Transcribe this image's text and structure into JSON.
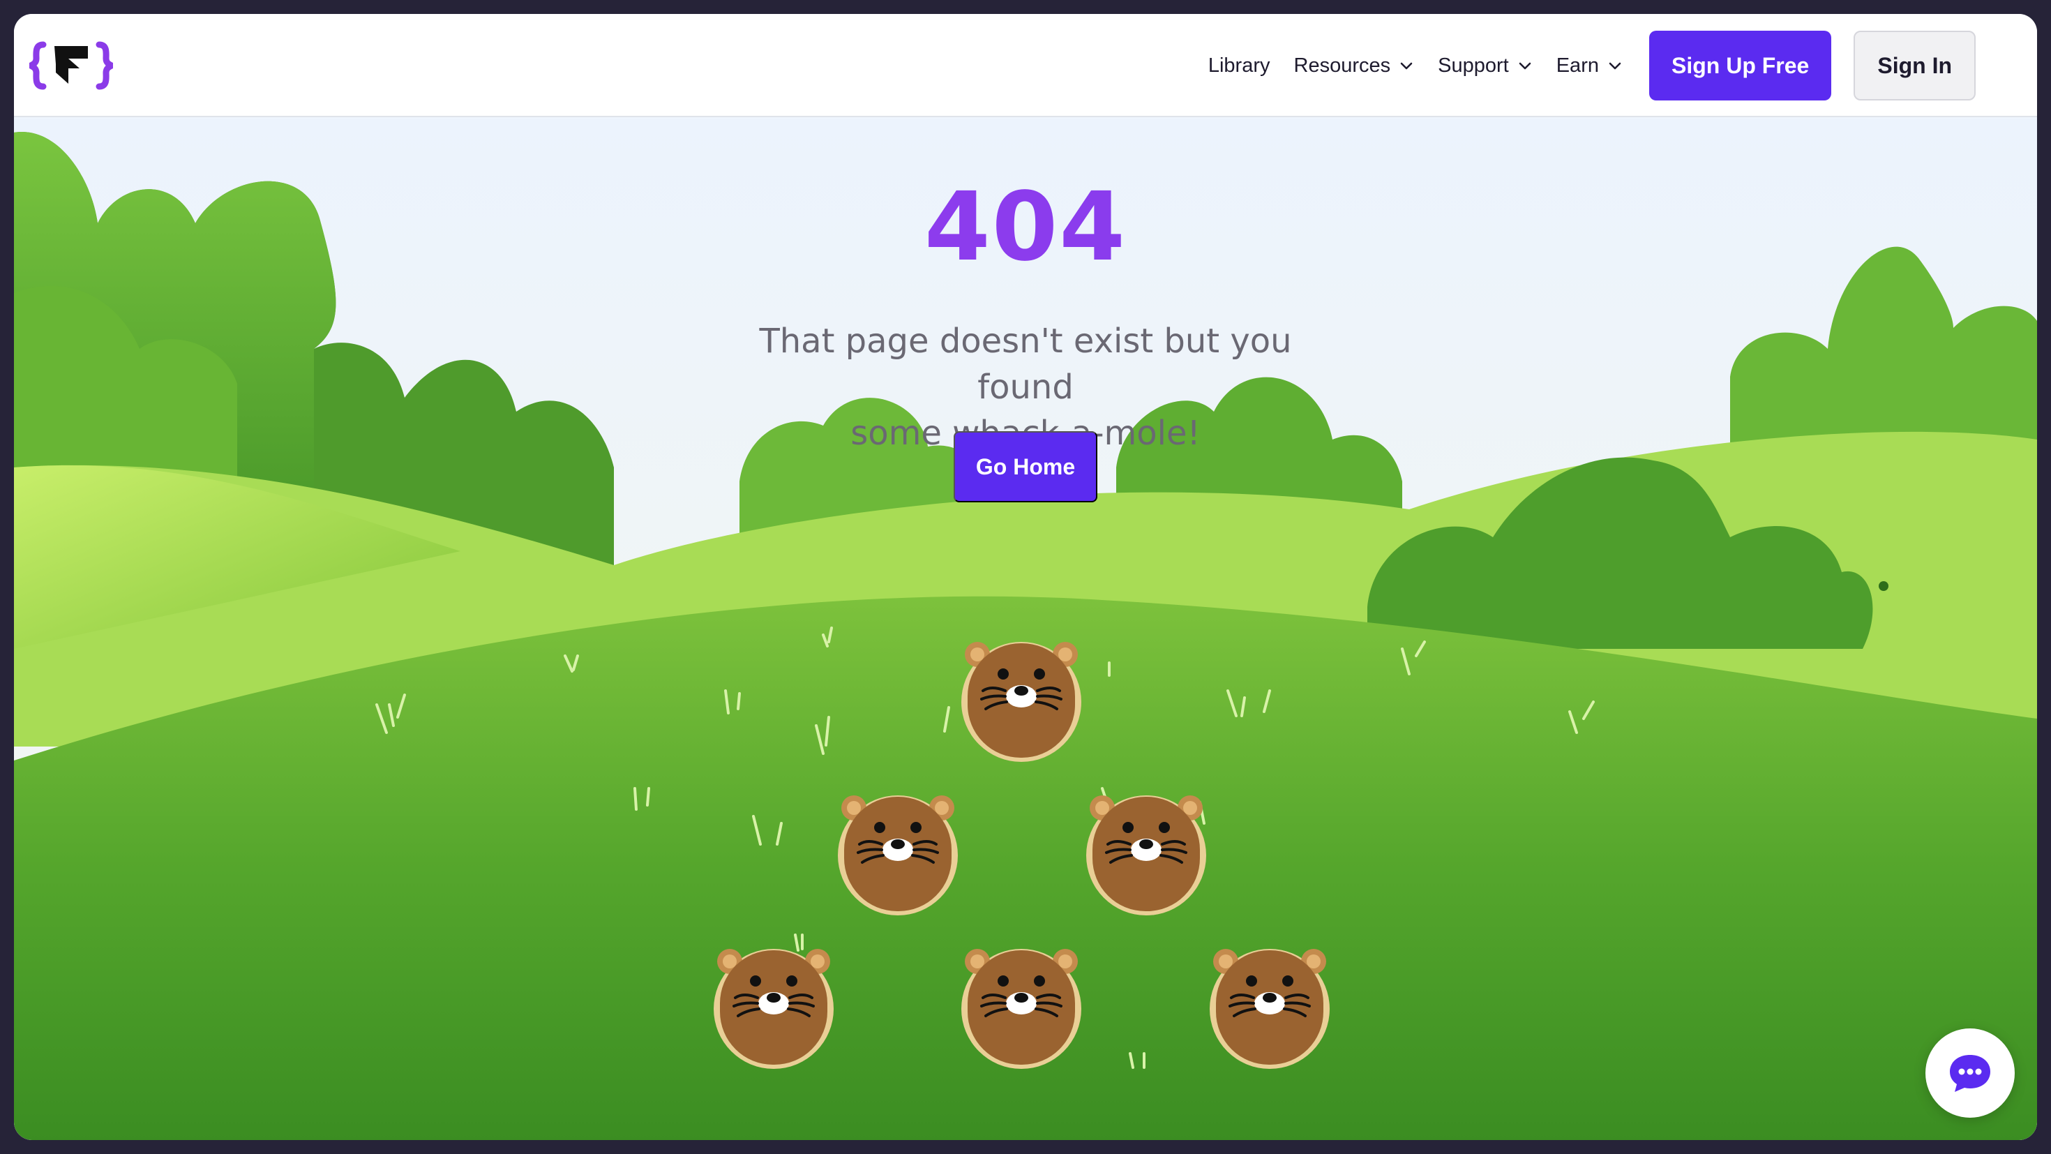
{
  "nav": {
    "brand": "{ }",
    "links": [
      {
        "label": "Library",
        "dropdown": false
      },
      {
        "label": "Resources",
        "dropdown": true
      },
      {
        "label": "Support",
        "dropdown": true
      },
      {
        "label": "Earn",
        "dropdown": true
      }
    ],
    "signup_label": "Sign Up Free",
    "signin_label": "Sign In"
  },
  "hero": {
    "code": "404",
    "tagline_line1": "That page doesn't exist but you found",
    "tagline_line2": "some whack-a-mole!",
    "home_label": "Go Home"
  },
  "game": {
    "mole_count": 6,
    "mole_icon": "mole-icon"
  },
  "icons": {
    "chat": "chat-bubble-icon",
    "chevron": "chevron-down-icon"
  },
  "colors": {
    "brand": "#5b2bf0",
    "code_gradient_start": "#9a3df0",
    "grass": "#5aa82f"
  }
}
